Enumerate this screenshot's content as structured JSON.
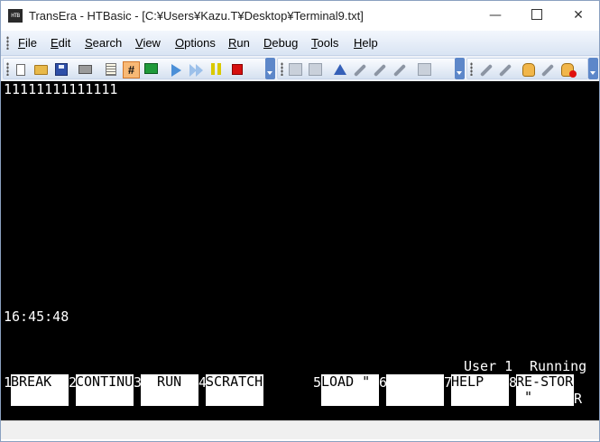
{
  "window": {
    "icon_text": "HTB",
    "title": "TransEra - HTBasic - [C:¥Users¥Kazu.T¥Desktop¥Terminal9.txt]",
    "controls": {
      "minimize": "—",
      "close": "✕"
    }
  },
  "menu": [
    {
      "key": "F",
      "rest": "ile"
    },
    {
      "key": "E",
      "rest": "dit"
    },
    {
      "key": "S",
      "rest": "earch"
    },
    {
      "key": "V",
      "rest": "iew"
    },
    {
      "key": "O",
      "rest": "ptions"
    },
    {
      "key": "R",
      "rest": "un"
    },
    {
      "key": "D",
      "rest": "ebug"
    },
    {
      "key": "T",
      "rest": "ools"
    },
    {
      "key": "H",
      "rest": "elp"
    }
  ],
  "toolbar": {
    "hash_label": "#",
    "icons": [
      "new-file-icon",
      "open-folder-icon",
      "save-icon",
      "print-icon",
      "list-icon",
      "line-numbers-icon",
      "monitor-icon",
      "run-icon",
      "continue-icon",
      "pause-icon",
      "stop-icon",
      "find-icon",
      "replace-icon",
      "step-icon",
      "step-into-icon",
      "step-over-icon",
      "breakpoint-icon",
      "tools-icon",
      "settings-icon",
      "hand-icon",
      "hand-stop-icon"
    ]
  },
  "terminal": {
    "output_line": "11111111111111",
    "time": "16:45:48",
    "status_user": "User 1",
    "status_state": "Running",
    "softkeys": [
      {
        "num": "1",
        "label": "BREAK"
      },
      {
        "num": "2",
        "label": "CONTINUE"
      },
      {
        "num": "3",
        "label": "  RUN"
      },
      {
        "num": "4",
        "label": "SCRATCH"
      },
      {
        "num": "5",
        "label": "LOAD \""
      },
      {
        "num": "6",
        "label": ""
      },
      {
        "num": "7",
        "label": "HELP"
      },
      {
        "num": "8",
        "label": "RE-STORE\n \""
      }
    ],
    "softkey_suffix": "R"
  },
  "colors": {
    "terminal_bg": "#000000",
    "terminal_fg": "#ffffff",
    "softkey_bg": "#ffffff",
    "menubar": "#dfe8f5",
    "toolbar_accent": "#5d87c9"
  }
}
